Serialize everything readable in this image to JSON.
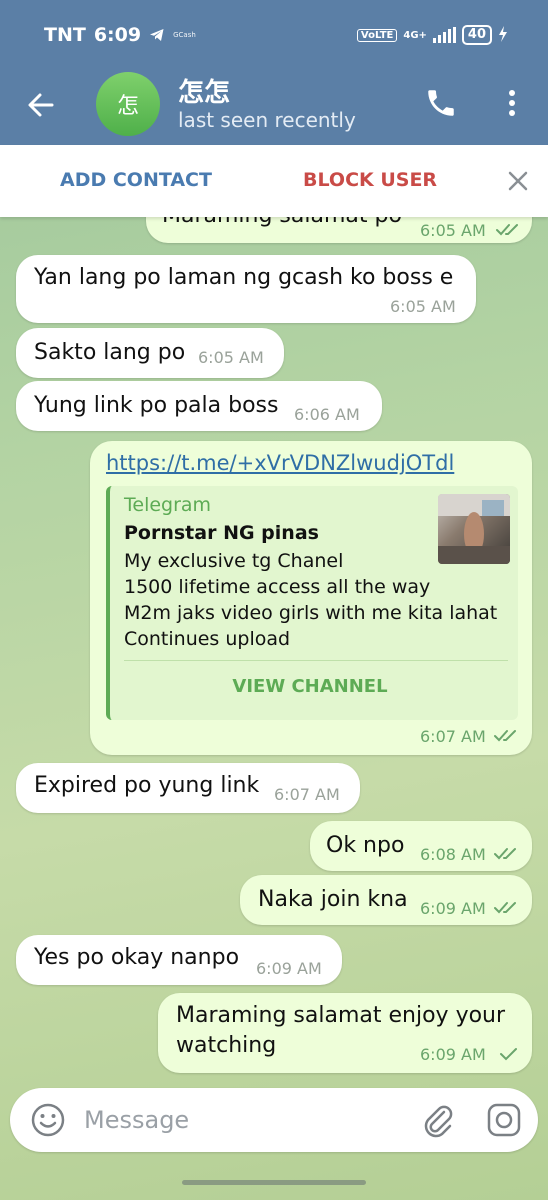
{
  "status_bar": {
    "carrier": "TNT",
    "time": "6:09",
    "app_notice": "GCash",
    "volte": "VoLTE",
    "network": "4G+",
    "battery": "40"
  },
  "header": {
    "avatar_text": "怎",
    "title": "怎怎",
    "subtitle": "last seen recently"
  },
  "action_bar": {
    "add_contact": "ADD CONTACT",
    "block_user": "BLOCK USER"
  },
  "messages": [
    {
      "direction": "out",
      "text": "Maraming salamat po",
      "time": "6:05 AM",
      "status": "read"
    },
    {
      "direction": "in",
      "text": "Yan lang po laman ng gcash ko boss e",
      "time": "6:05 AM"
    },
    {
      "direction": "in",
      "text": "Sakto lang po",
      "time": "6:05 AM"
    },
    {
      "direction": "in",
      "text": "Yung link po pala boss",
      "time": "6:06 AM"
    },
    {
      "direction": "out",
      "text": "https://t.me/+xVrVDNZlwudjOTdl",
      "time": "6:07 AM",
      "status": "read",
      "preview": {
        "site": "Telegram",
        "title": "Pornstar NG pinas",
        "description": [
          "My exclusive tg Chanel",
          "1500 lifetime access all the way",
          "M2m jaks video girls with me kita lahat",
          "Continues upload"
        ],
        "button": "VIEW CHANNEL"
      }
    },
    {
      "direction": "in",
      "text": "Expired po yung link",
      "time": "6:07 AM"
    },
    {
      "direction": "out",
      "text": "Ok npo",
      "time": "6:08 AM",
      "status": "read"
    },
    {
      "direction": "out",
      "text": "Naka join kna",
      "time": "6:09 AM",
      "status": "read"
    },
    {
      "direction": "in",
      "text": "Yes po okay nanpo",
      "time": "6:09 AM"
    },
    {
      "direction": "out",
      "text_lines": [
        "Maraming salamat enjoy your",
        "watching"
      ],
      "time": "6:09 AM",
      "status": "sent"
    }
  ],
  "input": {
    "placeholder": "Message"
  },
  "colors": {
    "header_bg": "#5b7fa6",
    "outgoing_bubble": "#eefed9",
    "incoming_bubble": "#ffffff",
    "accent_green": "#5dab55",
    "link_blue": "#2f6ea6",
    "block_red": "#c94b47"
  }
}
